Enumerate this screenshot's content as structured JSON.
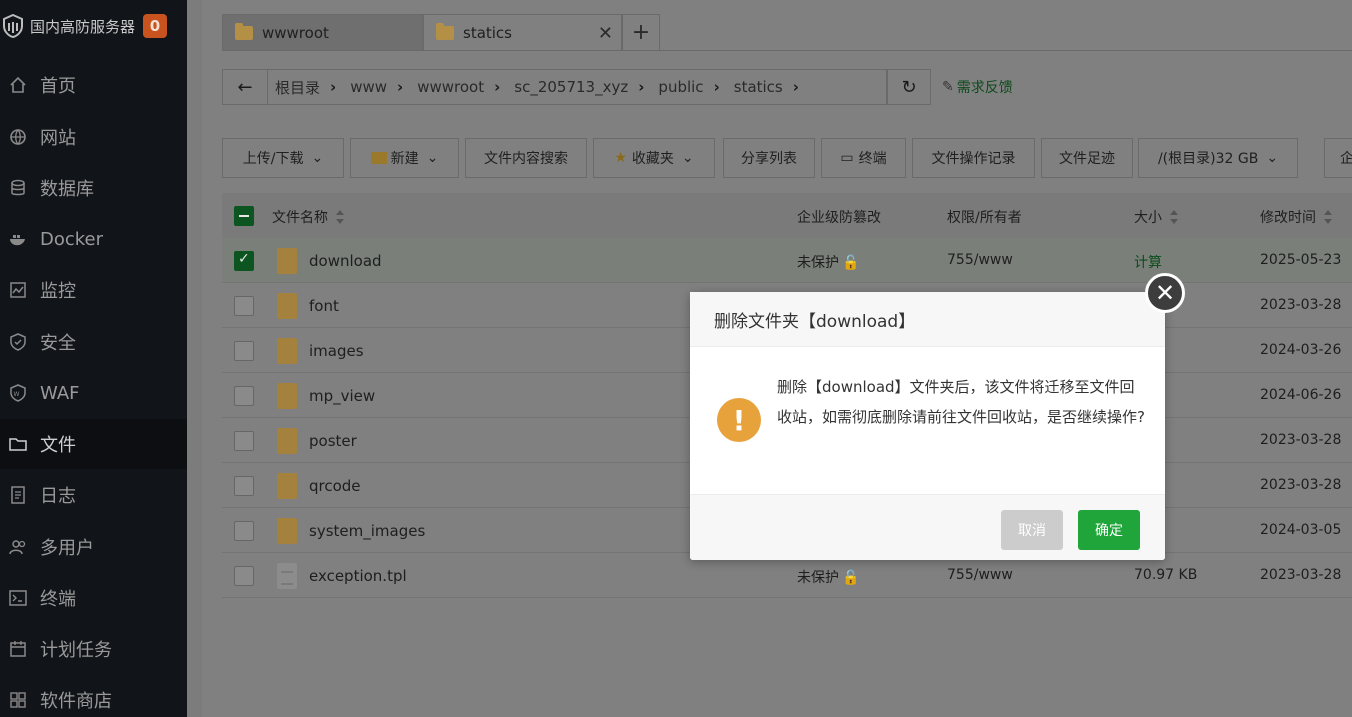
{
  "sidebar": {
    "brand_title": "国内高防服务器",
    "badge_count": "0",
    "items": [
      {
        "label": "首页",
        "icon": "home-icon"
      },
      {
        "label": "网站",
        "icon": "globe-icon"
      },
      {
        "label": "数据库",
        "icon": "database-icon"
      },
      {
        "label": "Docker",
        "icon": "docker-icon"
      },
      {
        "label": "监控",
        "icon": "monitor-icon"
      },
      {
        "label": "安全",
        "icon": "shield-icon"
      },
      {
        "label": "WAF",
        "icon": "waf-icon"
      },
      {
        "label": "文件",
        "icon": "folder-icon",
        "active": true
      },
      {
        "label": "日志",
        "icon": "log-icon"
      },
      {
        "label": "多用户",
        "icon": "users-icon"
      },
      {
        "label": "终端",
        "icon": "terminal-icon"
      },
      {
        "label": "计划任务",
        "icon": "calendar-icon"
      },
      {
        "label": "软件商店",
        "icon": "apps-icon"
      }
    ]
  },
  "tabs": [
    {
      "label": "wwwroot"
    },
    {
      "label": "statics"
    }
  ],
  "breadcrumb": [
    "根目录",
    "www",
    "wwwroot",
    "sc_205713_xyz",
    "public",
    "statics"
  ],
  "feedback_label": "需求反馈",
  "toolbar": {
    "upload": "上传/下载",
    "new": "新建",
    "search": "文件内容搜索",
    "favorites": "收藏夹",
    "share": "分享列表",
    "terminal": "终端",
    "oplog": "文件操作记录",
    "footprint": "文件足迹",
    "disk": "/(根目录)32 GB",
    "more": "企"
  },
  "table": {
    "headers": {
      "name": "文件名称",
      "protect": "企业级防篡改",
      "perm": "权限/所有者",
      "size": "大小",
      "mtime": "修改时间"
    },
    "rows": [
      {
        "name": "download",
        "protect": "未保护",
        "perm": "755/www",
        "size": "计算",
        "mtime": "2025-05-23",
        "type": "folder",
        "selected": true
      },
      {
        "name": "font",
        "mtime": "2023-03-28",
        "type": "folder"
      },
      {
        "name": "images",
        "mtime": "2024-03-26",
        "type": "folder"
      },
      {
        "name": "mp_view",
        "mtime": "2024-06-26",
        "type": "folder"
      },
      {
        "name": "poster",
        "mtime": "2023-03-28",
        "type": "folder"
      },
      {
        "name": "qrcode",
        "mtime": "2023-03-28",
        "type": "folder"
      },
      {
        "name": "system_images",
        "mtime": "2024-03-05",
        "type": "folder"
      },
      {
        "name": "exception.tpl",
        "protect": "未保护",
        "perm": "755/www",
        "size": "70.97 KB",
        "mtime": "2023-03-28",
        "type": "file"
      }
    ]
  },
  "dialog": {
    "title": "删除文件夹【download】",
    "message": "删除【download】文件夹后，该文件将迁移至文件回收站，如需彻底删除请前往文件回收站，是否继续操作?",
    "cancel": "取消",
    "confirm": "确定",
    "accent_color": "#20a53a",
    "warn_color": "#e8a23c"
  }
}
